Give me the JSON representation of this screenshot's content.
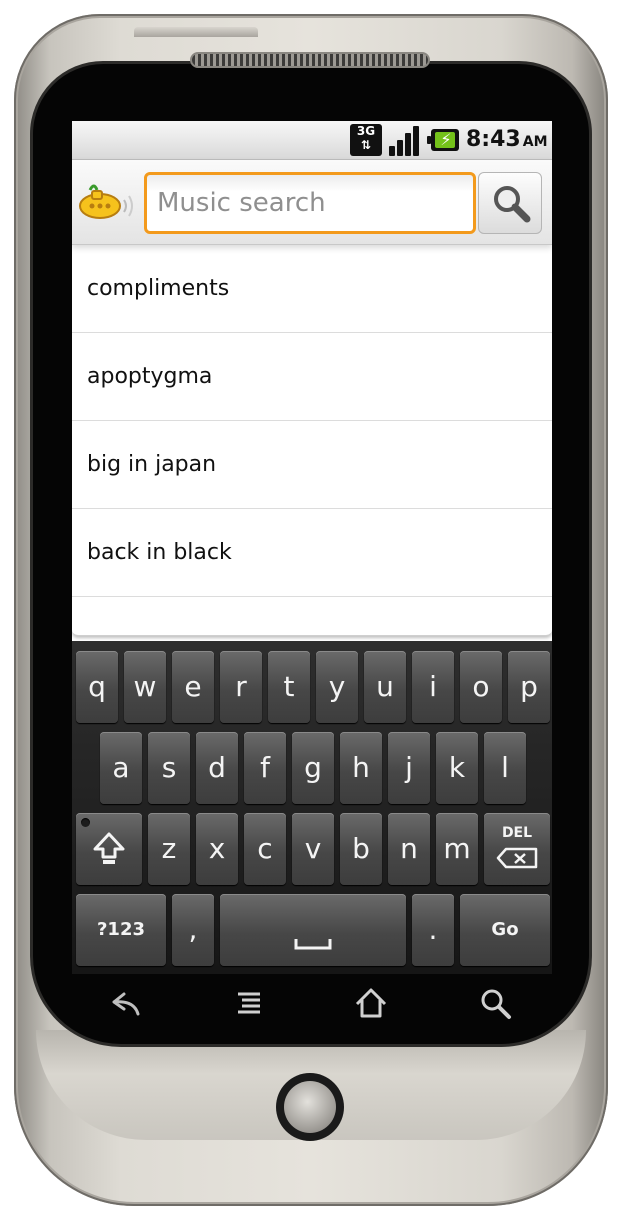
{
  "status_bar": {
    "network_label_top": "3G",
    "network_label_bottom": "⇅",
    "signal_bars": 4,
    "battery_bolt": "⚡",
    "time": "8:43",
    "ampm": "AM"
  },
  "search": {
    "placeholder": "Music search",
    "value": ""
  },
  "suggestions": [
    "compliments",
    "apoptygma",
    "big in japan",
    "back in black"
  ],
  "keyboard": {
    "row1": [
      "q",
      "w",
      "e",
      "r",
      "t",
      "y",
      "u",
      "i",
      "o",
      "p"
    ],
    "row2": [
      "a",
      "s",
      "d",
      "f",
      "g",
      "h",
      "j",
      "k",
      "l"
    ],
    "row3": [
      "z",
      "x",
      "c",
      "v",
      "b",
      "n",
      "m"
    ],
    "delete_label": "DEL",
    "symbols_label": "?123",
    "comma_label": ",",
    "period_label": ".",
    "go_label": "Go"
  },
  "colors": {
    "accent": "#f39a1c",
    "battery": "#74c21a"
  },
  "icons": {
    "logo": "yellow-submarine-icon",
    "search": "magnifier-icon",
    "shift": "shift-arrow-icon",
    "delete": "backspace-icon",
    "space": "space-bar-icon",
    "nav": [
      "back-arrow-icon",
      "menu-icon",
      "home-icon",
      "search-icon"
    ]
  }
}
